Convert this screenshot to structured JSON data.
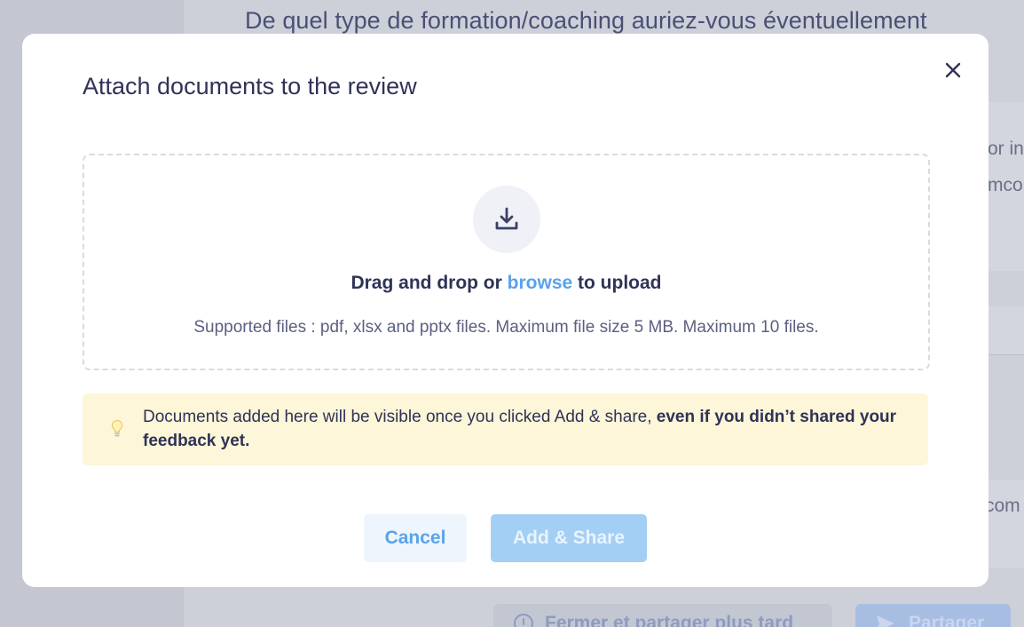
{
  "background": {
    "heading": "De quel type de formation/coaching auriez-vous éventuellement",
    "snippet_1": "or in",
    "snippet_2": "mco",
    "snippet_3": "com",
    "later_button_label": "Fermer et partager plus tard",
    "share_button_label": "Partager"
  },
  "modal": {
    "title": "Attach documents to the review",
    "dropzone": {
      "prefix": "Drag and drop or ",
      "browse_label": "browse",
      "suffix": " to upload",
      "supported": "Supported files : pdf, xlsx and pptx files. Maximum file size 5 MB. Maximum 10 files."
    },
    "notice": {
      "text": "Documents added here will be visible once you clicked Add & share, ",
      "bold": "even if you didn’t shared your feedback yet."
    },
    "buttons": {
      "cancel_label": "Cancel",
      "add_share_label": "Add & Share"
    }
  },
  "colors": {
    "accent": "#5aa2ea",
    "title_text": "#2f3356",
    "notice_bg": "#fdf6d9",
    "add_share_disabled": "#a4cff5"
  },
  "icons": {
    "close": "close-icon",
    "upload": "download-tray-icon",
    "notice": "lightbulb-icon",
    "clock": "clock-icon",
    "send": "send-icon"
  }
}
